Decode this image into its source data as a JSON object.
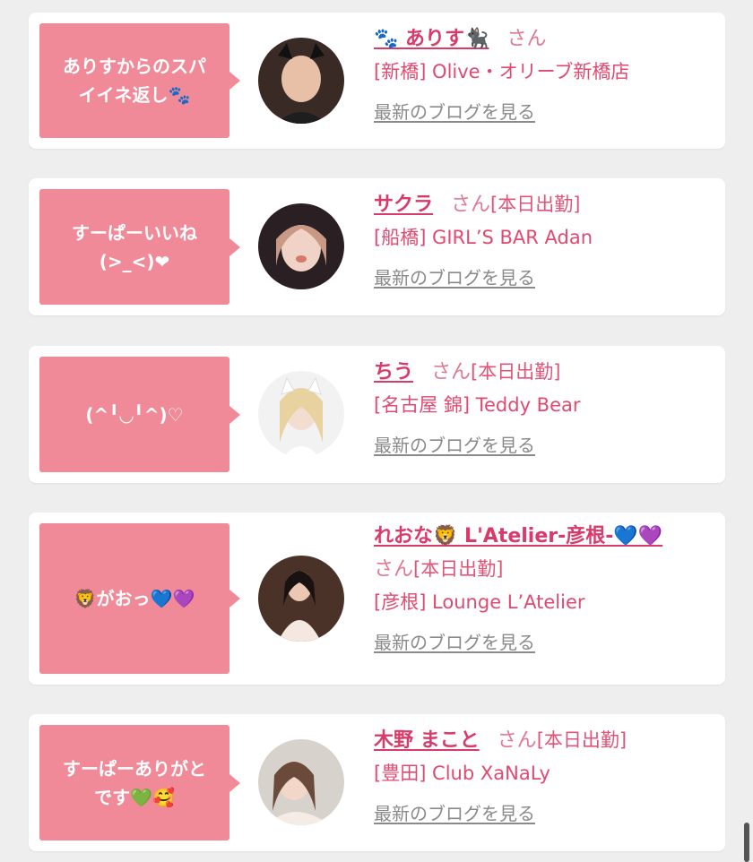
{
  "items": [
    {
      "message": "ありすからのスパ\nイイネ返し🐾",
      "name": "🐾 ありす🐈‍⬛",
      "honorific": "さん",
      "status": "",
      "shop": "[新橋] Olive・オリーブ新橋店",
      "blog_link": "最新のブログを見る"
    },
    {
      "message": "すーぱーいいね\n(>_<)❤",
      "name": "サクラ",
      "honorific": "さん",
      "status": "[本日出勤]",
      "shop": "[船橋] GIRL’S BAR Adan",
      "blog_link": "最新のブログを見る"
    },
    {
      "message": "(^╹◡╹^)♡",
      "name": "ちう",
      "honorific": "さん",
      "status": "[本日出勤]",
      "shop": "[名古屋 錦] Teddy Bear",
      "blog_link": "最新のブログを見る"
    },
    {
      "message": "🦁がおっ💙💜",
      "name": "れおな🦁 L'Atelier-彦根-💙💜",
      "honorific": "さん",
      "status": "[本日出勤]",
      "shop": "[彦根] Lounge L’Atelier",
      "blog_link": "最新のブログを見る"
    },
    {
      "message": "すーぱーありがと\nです💚🥰",
      "name": "木野 まこと",
      "honorific": "さん",
      "status": "[本日出勤]",
      "shop": "[豊田] Club XaNaLy",
      "blog_link": "最新のブログを見る"
    }
  ],
  "colors": {
    "accent": "#d83a6a",
    "bubble": "#f18a98",
    "link_gray": "#8a8a8a",
    "background": "#eeeeee"
  }
}
